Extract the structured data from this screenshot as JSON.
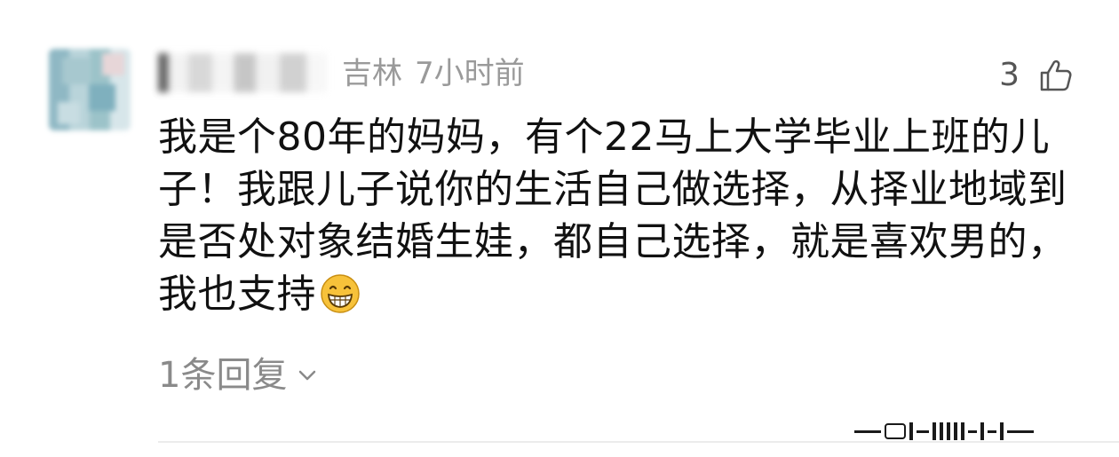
{
  "comment": {
    "location": "吉林",
    "time": "7小时前",
    "like_count": "3",
    "text": "我是个80年的妈妈，有个22马上大学毕业上班的儿子！我跟儿子说你的生活自己做选择，从择业地域到是否处对象结婚生娃，都自己选择，就是喜欢男的，我也支持",
    "reply_label": "1条回复"
  },
  "icons": {
    "like": "thumbs-up-icon",
    "emoji": "grinning-face-emoji",
    "expand": "chevron-down-icon"
  },
  "colors": {
    "meta": "#9a9a9a",
    "text": "#111111",
    "reply": "#8a8a8a",
    "emoji": "#f7c23a"
  }
}
